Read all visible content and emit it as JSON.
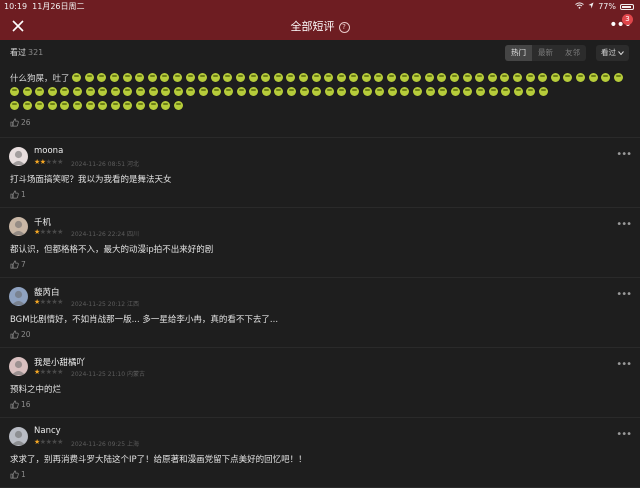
{
  "status": {
    "time": "10:19",
    "date": "11月26日周二",
    "battery": "77%"
  },
  "nav": {
    "title": "全部短评",
    "badge": "3"
  },
  "filter": {
    "label": "看过",
    "count": "321",
    "tabs": [
      "热门",
      "最新",
      "友邻"
    ],
    "active_tab": 0,
    "dropdown": "看过"
  },
  "first_review": {
    "text": "什么狗屎，吐了",
    "emoji_line1": 44,
    "emoji_line2": 43,
    "emoji_line3": 14,
    "likes": "26"
  },
  "reviews": [
    {
      "user": "moona",
      "rating": 2,
      "meta": "2024-11-26 08:51 河北",
      "text": "打斗场面搞笑呢？我以为我看的是舞法天女",
      "likes": "1",
      "avatar_color": "#e8dede"
    },
    {
      "user": "千机",
      "rating": 1,
      "meta": "2024-11-26 22:24 四川",
      "text": "都认识，但都格格不入，最大的动漫ip拍不出来好的剧",
      "likes": "7",
      "avatar_color": "#c9b7a6"
    },
    {
      "user": "馥芮白",
      "rating": 1,
      "meta": "2024-11-25 20:12 江西",
      "text": "BGM比剧情好，不如肖战那一版... 多一星给李小冉，真的看不下去了...",
      "likes": "20",
      "avatar_color": "#8fa2c0"
    },
    {
      "user": "我是小甜橘吖",
      "rating": 1,
      "meta": "2024-11-25 21:10 内蒙古",
      "text": "预料之中的烂",
      "likes": "16",
      "avatar_color": "#d9c0c0"
    },
    {
      "user": "Nancy",
      "rating": 1,
      "meta": "2024-11-26 09:25 上海",
      "text": "求求了，别再消费斗罗大陆这个IP了！给原著和漫画党留下点美好的回忆吧！！",
      "likes": "1",
      "avatar_color": "#b9bcc4"
    }
  ],
  "colors": {
    "header": "#6e1d22",
    "star_on": "#f5a623",
    "star_off": "#4a4a4a"
  }
}
